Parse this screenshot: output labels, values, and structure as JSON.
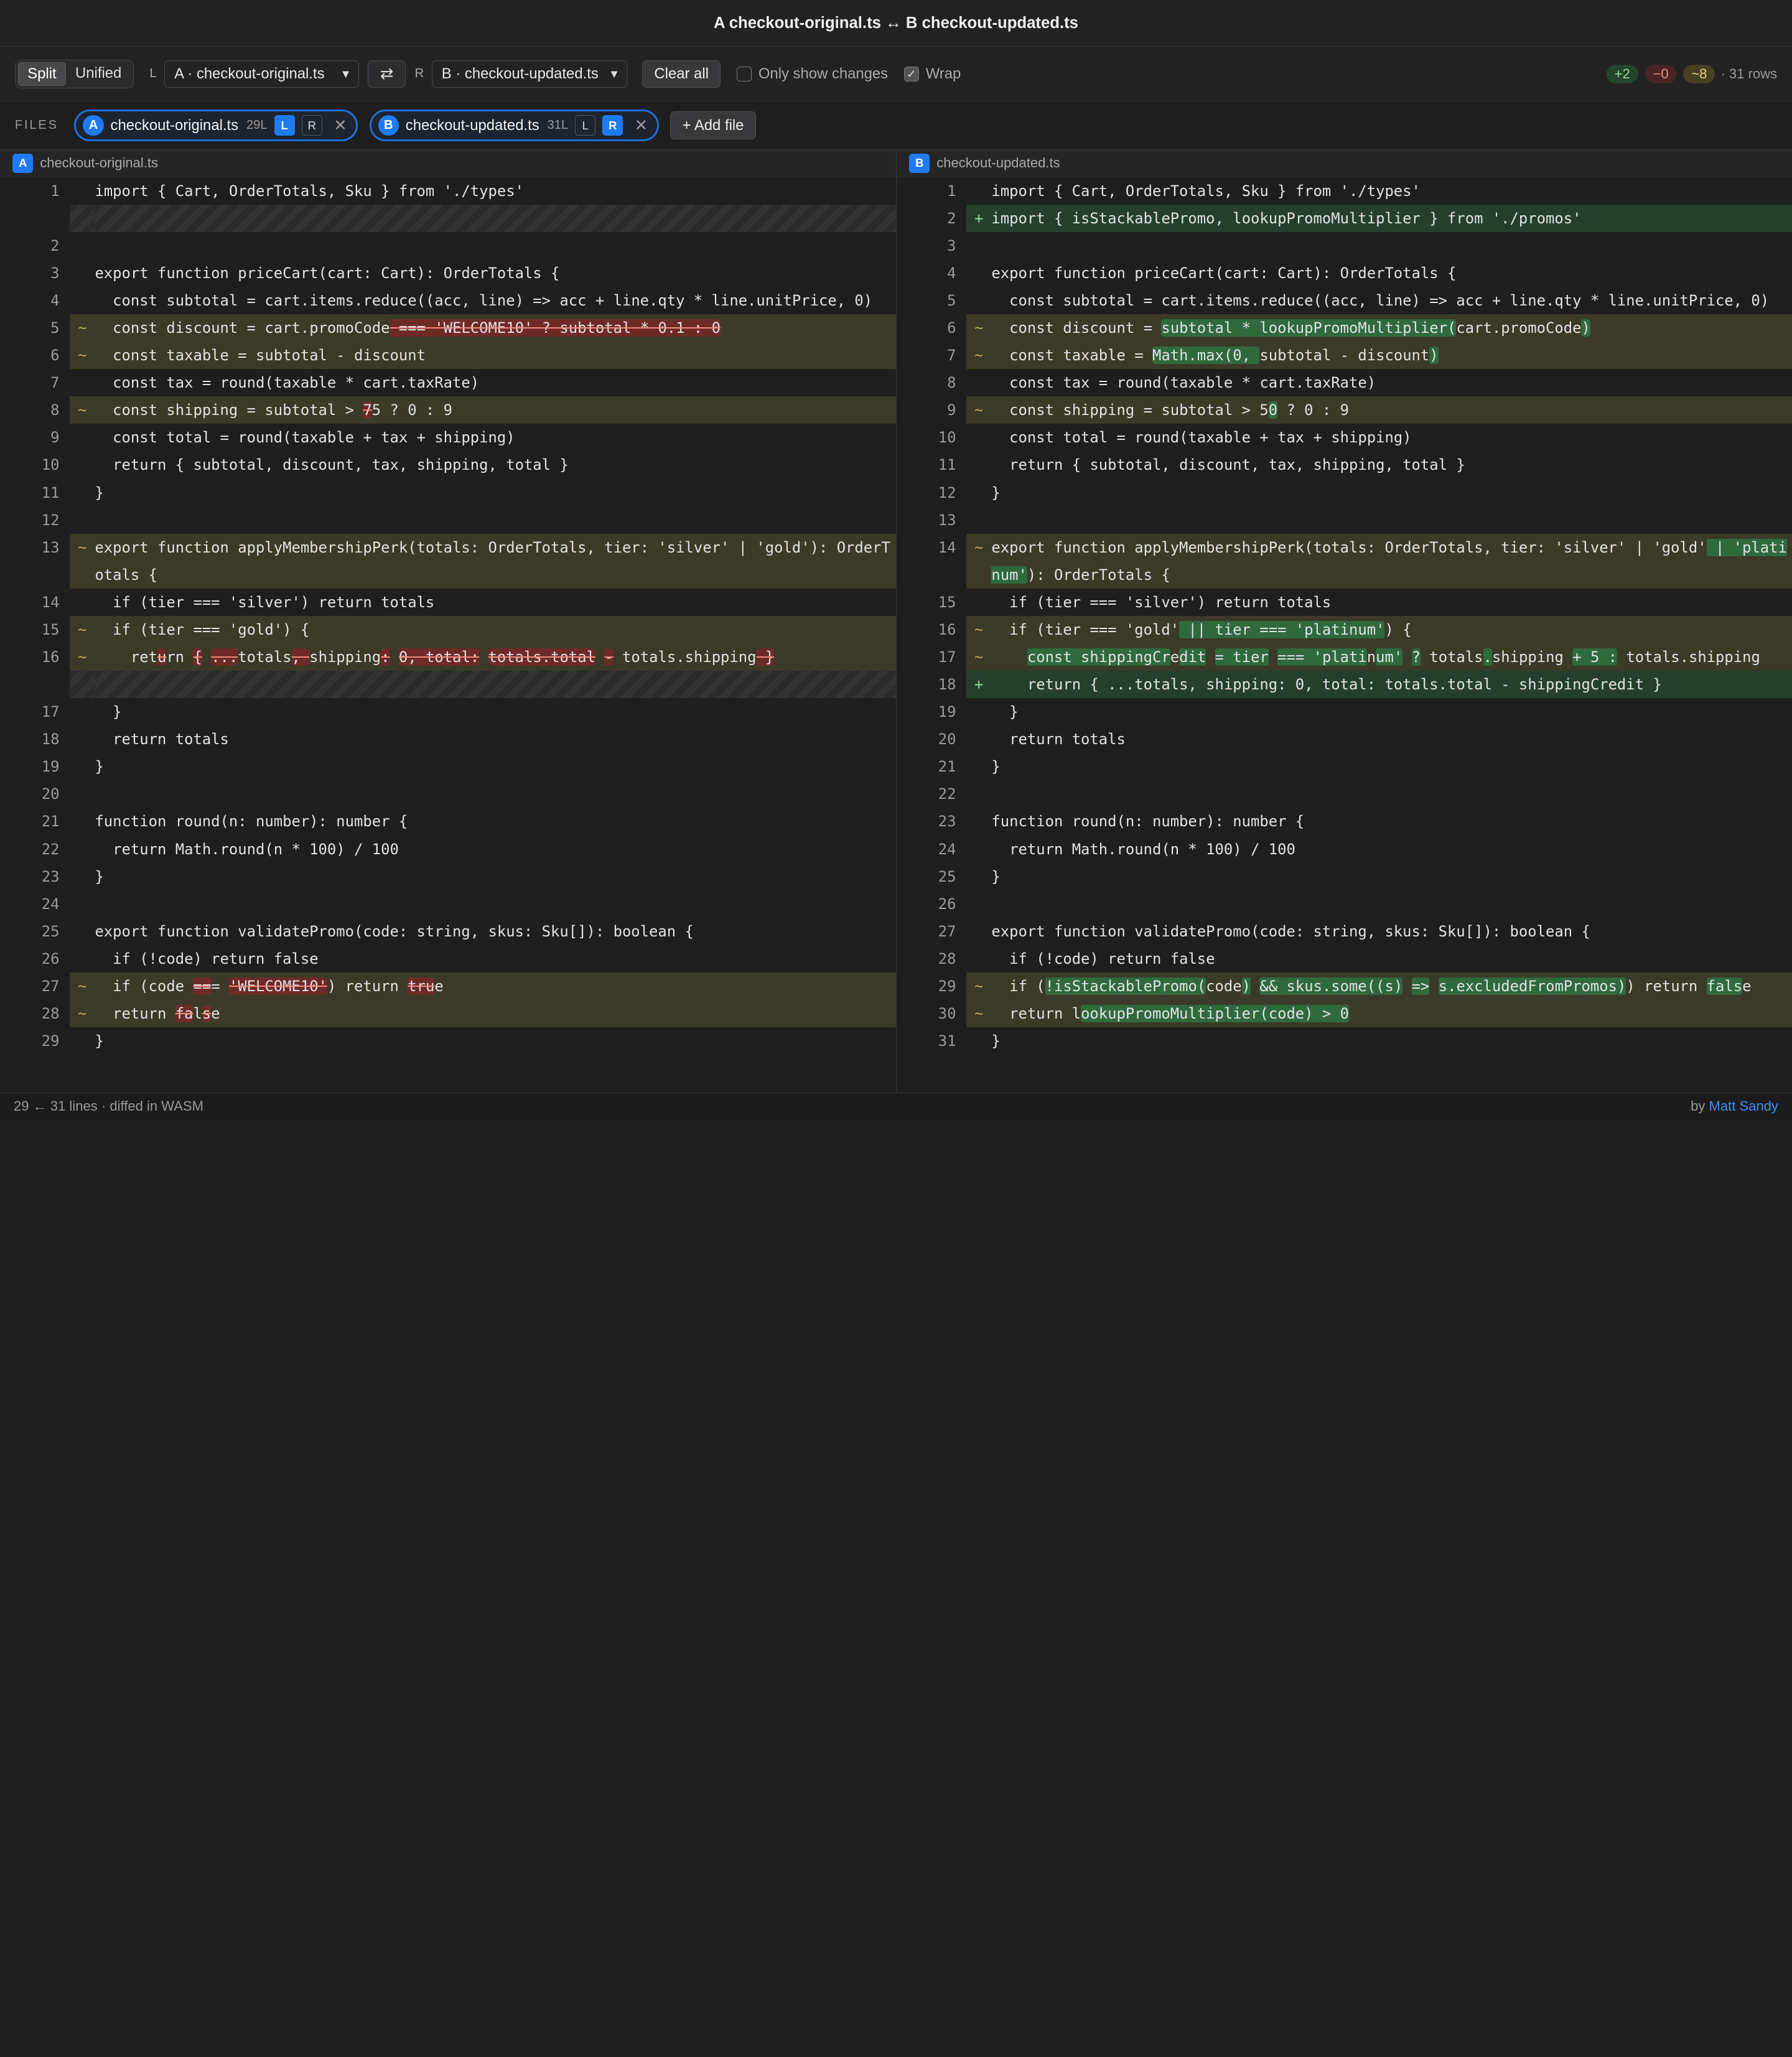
{
  "window": {
    "title": "A checkout-original.ts ↔ B checkout-updated.ts"
  },
  "toolbar": {
    "view_modes": [
      {
        "label": "Split",
        "active": true
      },
      {
        "label": "Unified",
        "active": false
      }
    ],
    "left_label": "L",
    "left_select": "A · checkout-original.ts",
    "swap_icon": "⇄",
    "right_label": "R",
    "right_select": "B · checkout-updated.ts",
    "clear_label": "Clear all",
    "only_changes": {
      "label": "Only show changes",
      "checked": false
    },
    "wrap": {
      "label": "Wrap",
      "checked": true
    },
    "stats": {
      "added": "+2",
      "removed": "−0",
      "modified": "~8",
      "rows": "· 31 rows"
    }
  },
  "files": {
    "label": "FILES",
    "chips": [
      {
        "badge": "A",
        "name": "checkout-original.ts",
        "lines": "29L",
        "left": true,
        "right": false,
        "close": "✕"
      },
      {
        "badge": "B",
        "name": "checkout-updated.ts",
        "lines": "31L",
        "left": false,
        "right": true,
        "close": "✕"
      }
    ],
    "toggle_l": "L",
    "toggle_r": "R",
    "add_label": "+ Add file"
  },
  "panes": {
    "left": {
      "badge": "A",
      "name": "checkout-original.ts"
    },
    "right": {
      "badge": "B",
      "name": "checkout-updated.ts"
    }
  },
  "marks": {
    "mod": "~",
    "add": "+"
  },
  "diff_left": [
    {
      "ln": "1",
      "type": "eq",
      "segs": [
        [
          "import { Cart, OrderTotals, Sku } from './types'",
          ""
        ]
      ]
    },
    {
      "ln": "",
      "type": "filler",
      "segs": []
    },
    {
      "ln": "2",
      "type": "eq",
      "segs": [
        [
          "",
          ""
        ]
      ]
    },
    {
      "ln": "3",
      "type": "eq",
      "segs": [
        [
          "export function priceCart(cart: Cart): OrderTotals {",
          ""
        ]
      ]
    },
    {
      "ln": "4",
      "type": "eq",
      "segs": [
        [
          "  const subtotal = cart.items.reduce((acc, line) => acc + line.qty * line.unitPrice, 0)",
          ""
        ]
      ]
    },
    {
      "ln": "5",
      "type": "mod",
      "segs": [
        [
          "  const discount = cart.promoCode",
          ""
        ],
        [
          " === 'WELCOME10' ? subtotal * 0.1 : 0",
          "d"
        ]
      ]
    },
    {
      "ln": "6",
      "type": "mod",
      "segs": [
        [
          "  const taxable = subtotal - discount",
          ""
        ]
      ]
    },
    {
      "ln": "7",
      "type": "eq",
      "segs": [
        [
          "  const tax = round(taxable * cart.taxRate)",
          ""
        ]
      ]
    },
    {
      "ln": "8",
      "type": "mod",
      "segs": [
        [
          "  const shipping = subtotal > ",
          ""
        ],
        [
          "7",
          "d"
        ],
        [
          "5 ? 0 : 9",
          ""
        ]
      ]
    },
    {
      "ln": "9",
      "type": "eq",
      "segs": [
        [
          "  const total = round(taxable + tax + shipping)",
          ""
        ]
      ]
    },
    {
      "ln": "10",
      "type": "eq",
      "segs": [
        [
          "  return { subtotal, discount, tax, shipping, total }",
          ""
        ]
      ]
    },
    {
      "ln": "11",
      "type": "eq",
      "segs": [
        [
          "}",
          ""
        ]
      ]
    },
    {
      "ln": "12",
      "type": "eq",
      "segs": [
        [
          "",
          ""
        ]
      ]
    },
    {
      "ln": "13",
      "type": "mod",
      "segs": [
        [
          "export function applyMembershipPerk(totals: OrderTotals, tier: 'silver' | 'gold'): OrderTotals {",
          ""
        ]
      ]
    },
    {
      "ln": "14",
      "type": "eq",
      "segs": [
        [
          "  if (tier === 'silver') return totals",
          ""
        ]
      ]
    },
    {
      "ln": "15",
      "type": "mod",
      "segs": [
        [
          "  if (tier === 'gold') {",
          ""
        ]
      ]
    },
    {
      "ln": "16",
      "type": "mod",
      "segs": [
        [
          "    ret",
          ""
        ],
        [
          "u",
          "d"
        ],
        [
          "rn ",
          ""
        ],
        [
          "{",
          "d"
        ],
        [
          " ",
          ""
        ],
        [
          "...",
          "d"
        ],
        [
          "totals",
          ""
        ],
        [
          ", ",
          "d"
        ],
        [
          "shipping",
          ""
        ],
        [
          ":",
          "d"
        ],
        [
          " ",
          ""
        ],
        [
          "0, total:",
          "d"
        ],
        [
          " ",
          ""
        ],
        [
          "totals.total",
          "d"
        ],
        [
          " ",
          ""
        ],
        [
          "-",
          "d"
        ],
        [
          " totals.shipping",
          ""
        ],
        [
          " }",
          "d"
        ]
      ]
    },
    {
      "ln": "",
      "type": "filler",
      "segs": []
    },
    {
      "ln": "17",
      "type": "eq",
      "segs": [
        [
          "  }",
          ""
        ]
      ]
    },
    {
      "ln": "18",
      "type": "eq",
      "segs": [
        [
          "  return totals",
          ""
        ]
      ]
    },
    {
      "ln": "19",
      "type": "eq",
      "segs": [
        [
          "}",
          ""
        ]
      ]
    },
    {
      "ln": "20",
      "type": "eq",
      "segs": [
        [
          "",
          ""
        ]
      ]
    },
    {
      "ln": "21",
      "type": "eq",
      "segs": [
        [
          "function round(n: number): number {",
          ""
        ]
      ]
    },
    {
      "ln": "22",
      "type": "eq",
      "segs": [
        [
          "  return Math.round(n * 100) / 100",
          ""
        ]
      ]
    },
    {
      "ln": "23",
      "type": "eq",
      "segs": [
        [
          "}",
          ""
        ]
      ]
    },
    {
      "ln": "24",
      "type": "eq",
      "segs": [
        [
          "",
          ""
        ]
      ]
    },
    {
      "ln": "25",
      "type": "eq",
      "segs": [
        [
          "export function validatePromo(code: string, skus: Sku[]): boolean {",
          ""
        ]
      ]
    },
    {
      "ln": "26",
      "type": "eq",
      "segs": [
        [
          "  if (!code) return false",
          ""
        ]
      ]
    },
    {
      "ln": "27",
      "type": "mod",
      "segs": [
        [
          "  if (code ",
          ""
        ],
        [
          "==",
          "d"
        ],
        [
          "= ",
          ""
        ],
        [
          "'WELCOME10'",
          "d"
        ],
        [
          ") return ",
          ""
        ],
        [
          "tru",
          "d"
        ],
        [
          "e",
          ""
        ]
      ]
    },
    {
      "ln": "28",
      "type": "mod",
      "segs": [
        [
          "  return ",
          ""
        ],
        [
          "fa",
          "d"
        ],
        [
          "l",
          ""
        ],
        [
          "s",
          "d"
        ],
        [
          "e",
          ""
        ]
      ]
    },
    {
      "ln": "29",
      "type": "eq",
      "segs": [
        [
          "}",
          ""
        ]
      ]
    }
  ],
  "diff_right": [
    {
      "ln": "1",
      "type": "eq",
      "segs": [
        [
          "import { Cart, OrderTotals, Sku } from './types'",
          ""
        ]
      ]
    },
    {
      "ln": "2",
      "type": "add",
      "segs": [
        [
          "import { isStackablePromo, lookupPromoMultiplier } from './promos'",
          ""
        ]
      ]
    },
    {
      "ln": "3",
      "type": "eq",
      "segs": [
        [
          "",
          ""
        ]
      ]
    },
    {
      "ln": "4",
      "type": "eq",
      "segs": [
        [
          "export function priceCart(cart: Cart): OrderTotals {",
          ""
        ]
      ]
    },
    {
      "ln": "5",
      "type": "eq",
      "segs": [
        [
          "  const subtotal = cart.items.reduce((acc, line) => acc + line.qty * line.unitPrice, 0)",
          ""
        ]
      ]
    },
    {
      "ln": "6",
      "type": "mod",
      "segs": [
        [
          "  const discount = ",
          ""
        ],
        [
          "subtotal * lookupPromoMultiplier(",
          "i"
        ],
        [
          "cart.promoCode",
          ""
        ],
        [
          ")",
          "i"
        ]
      ]
    },
    {
      "ln": "7",
      "type": "mod",
      "segs": [
        [
          "  const taxable = ",
          ""
        ],
        [
          "Math.max(0, ",
          "i"
        ],
        [
          "subtotal - discount",
          ""
        ],
        [
          ")",
          "i"
        ]
      ]
    },
    {
      "ln": "8",
      "type": "eq",
      "segs": [
        [
          "  const tax = round(taxable * cart.taxRate)",
          ""
        ]
      ]
    },
    {
      "ln": "9",
      "type": "mod",
      "segs": [
        [
          "  const shipping = subtotal > 5",
          ""
        ],
        [
          "0",
          "i"
        ],
        [
          " ? 0 : 9",
          ""
        ]
      ]
    },
    {
      "ln": "10",
      "type": "eq",
      "segs": [
        [
          "  const total = round(taxable + tax + shipping)",
          ""
        ]
      ]
    },
    {
      "ln": "11",
      "type": "eq",
      "segs": [
        [
          "  return { subtotal, discount, tax, shipping, total }",
          ""
        ]
      ]
    },
    {
      "ln": "12",
      "type": "eq",
      "segs": [
        [
          "}",
          ""
        ]
      ]
    },
    {
      "ln": "13",
      "type": "eq",
      "segs": [
        [
          "",
          ""
        ]
      ]
    },
    {
      "ln": "14",
      "type": "mod",
      "segs": [
        [
          "export function applyMembershipPerk(totals: OrderTotals, tier: 'silver' | 'gold'",
          ""
        ],
        [
          " | 'platinum'",
          "i"
        ],
        [
          "): OrderTotals {",
          ""
        ]
      ]
    },
    {
      "ln": "15",
      "type": "eq",
      "segs": [
        [
          "  if (tier === 'silver') return totals",
          ""
        ]
      ]
    },
    {
      "ln": "16",
      "type": "mod",
      "segs": [
        [
          "  if (tier === 'gold'",
          ""
        ],
        [
          " || tier === 'platinum'",
          "i"
        ],
        [
          ") {",
          ""
        ]
      ]
    },
    {
      "ln": "17",
      "type": "mod",
      "segs": [
        [
          "    ",
          ""
        ],
        [
          "const shippingCr",
          "i"
        ],
        [
          "e",
          ""
        ],
        [
          "dit",
          "i"
        ],
        [
          " ",
          ""
        ],
        [
          "= tier",
          "i"
        ],
        [
          " ",
          ""
        ],
        [
          "=== 'plati",
          "i"
        ],
        [
          "n",
          ""
        ],
        [
          "um'",
          "i"
        ],
        [
          " ",
          ""
        ],
        [
          "?",
          "i"
        ],
        [
          " totals",
          ""
        ],
        [
          ".",
          "i"
        ],
        [
          "shipping ",
          ""
        ],
        [
          "+ 5 :",
          "i"
        ],
        [
          " totals.shipping",
          ""
        ]
      ]
    },
    {
      "ln": "18",
      "type": "add",
      "segs": [
        [
          "    return { ...totals, shipping: 0, total: totals.total - shippingCredit }",
          ""
        ]
      ]
    },
    {
      "ln": "19",
      "type": "eq",
      "segs": [
        [
          "  }",
          ""
        ]
      ]
    },
    {
      "ln": "20",
      "type": "eq",
      "segs": [
        [
          "  return totals",
          ""
        ]
      ]
    },
    {
      "ln": "21",
      "type": "eq",
      "segs": [
        [
          "}",
          ""
        ]
      ]
    },
    {
      "ln": "22",
      "type": "eq",
      "segs": [
        [
          "",
          ""
        ]
      ]
    },
    {
      "ln": "23",
      "type": "eq",
      "segs": [
        [
          "function round(n: number): number {",
          ""
        ]
      ]
    },
    {
      "ln": "24",
      "type": "eq",
      "segs": [
        [
          "  return Math.round(n * 100) / 100",
          ""
        ]
      ]
    },
    {
      "ln": "25",
      "type": "eq",
      "segs": [
        [
          "}",
          ""
        ]
      ]
    },
    {
      "ln": "26",
      "type": "eq",
      "segs": [
        [
          "",
          ""
        ]
      ]
    },
    {
      "ln": "27",
      "type": "eq",
      "segs": [
        [
          "export function validatePromo(code: string, skus: Sku[]): boolean {",
          ""
        ]
      ]
    },
    {
      "ln": "28",
      "type": "eq",
      "segs": [
        [
          "  if (!code) return false",
          ""
        ]
      ]
    },
    {
      "ln": "29",
      "type": "mod",
      "segs": [
        [
          "  if (",
          ""
        ],
        [
          "!isStackablePromo(",
          "i"
        ],
        [
          "code",
          ""
        ],
        [
          ")",
          "i"
        ],
        [
          " ",
          ""
        ],
        [
          "&& skus.some((s)",
          "i"
        ],
        [
          " ",
          ""
        ],
        [
          "=>",
          "i"
        ],
        [
          " ",
          ""
        ],
        [
          "s.excludedFromPromos)",
          "i"
        ],
        [
          ") return ",
          ""
        ],
        [
          "fals",
          "i"
        ],
        [
          "e",
          ""
        ]
      ]
    },
    {
      "ln": "30",
      "type": "mod",
      "segs": [
        [
          "  return l",
          ""
        ],
        [
          "ookupPromoMultiplier(code) > 0",
          "i"
        ]
      ]
    },
    {
      "ln": "31",
      "type": "eq",
      "segs": [
        [
          "}",
          ""
        ]
      ]
    }
  ],
  "status": {
    "left": "29 ← 31 lines · diffed in WASM",
    "by": "by ",
    "author": "Matt Sandy"
  }
}
